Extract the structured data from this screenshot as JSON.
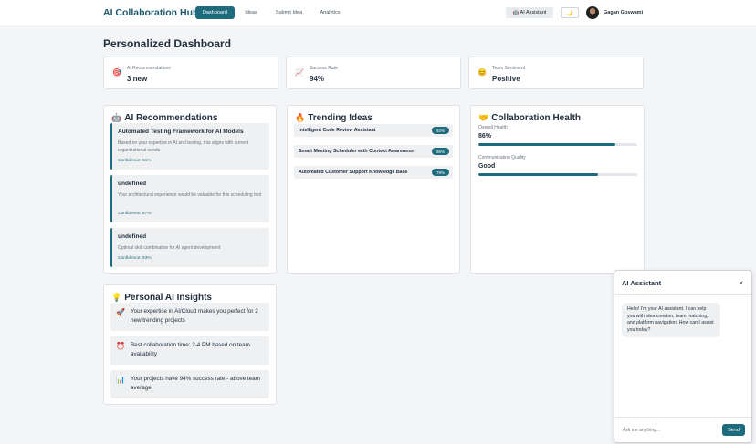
{
  "nav": {
    "brand": "AI Collaboration Hub",
    "links": [
      "Dashboard",
      "Ideas",
      "Submit Idea",
      "Analytics"
    ],
    "ai_button_icon": "🤖",
    "ai_button_label": "AI Assistant",
    "theme_icon": "🌙",
    "user_name": "Gagan Goswami",
    "accent_color": "#1e6b7d"
  },
  "page_title": "Personalized Dashboard",
  "stats": [
    {
      "icon": "🎯",
      "icon_name": "target-icon",
      "label": "AI Recommendations",
      "value": "3 new"
    },
    {
      "icon": "📈",
      "icon_name": "chart-up-icon",
      "label": "Success Rate",
      "value": "94%"
    },
    {
      "icon": "😊",
      "icon_name": "smile-icon",
      "label": "Team Sentiment",
      "value": "Positive"
    }
  ],
  "recommendations": {
    "icon": "🤖",
    "title": "AI Recommendations",
    "items": [
      {
        "title": "Automated Testing Framework for AI Models",
        "desc": "Based on your expertise in AI and testing, this aligns with current organizational needs",
        "confidence": "Confidence: 91%"
      },
      {
        "title": "undefined",
        "desc": "Your architectural experience would be valuable for this scheduling tool",
        "confidence": "Confidence: 87%"
      },
      {
        "title": "undefined",
        "desc": "Optimal skill combination for AI agent development",
        "confidence": "Confidence: 93%"
      }
    ]
  },
  "trending": {
    "icon": "🔥",
    "title": "Trending Ideas",
    "items": [
      {
        "title": "Intelligent Code Review Assistant",
        "score": "92%"
      },
      {
        "title": "Smart Meeting Scheduler with Context Awareness",
        "score": "85%"
      },
      {
        "title": "Automated Customer Support Knowledge Base",
        "score": "78%"
      }
    ]
  },
  "health": {
    "icon": "🤝",
    "title": "Collaboration Health",
    "overall_label": "Overall Health",
    "overall_value": "86%",
    "overall_fill": 0.86,
    "comm_label": "Communication Quality",
    "comm_value": "Good",
    "comm_fill": 0.75
  },
  "insights": {
    "icon": "💡",
    "title": "Personal AI Insights",
    "items": [
      {
        "icon": "🚀",
        "icon_name": "rocket-icon",
        "text": "Your expertise in AI/Cloud makes you perfect for 2 new trending projects"
      },
      {
        "icon": "⏰",
        "icon_name": "alarm-clock-icon",
        "text": "Best collaboration time: 2-4 PM based on team availability"
      },
      {
        "icon": "📊",
        "icon_name": "bar-chart-icon",
        "text": "Your projects have 94% success rate - above team average"
      }
    ]
  },
  "chat": {
    "title": "AI Assistant",
    "close": "×",
    "message": "Hello! I'm your AI assistant. I can help you with idea creation, team matching, and platform navigation. How can I assist you today?",
    "placeholder": "Ask me anything...",
    "send": "Send"
  }
}
